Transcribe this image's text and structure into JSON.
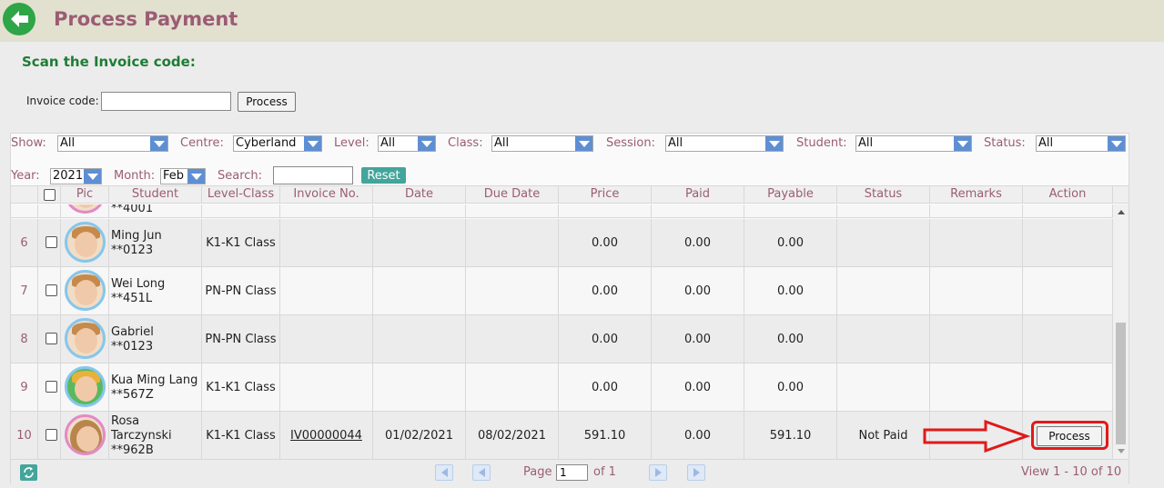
{
  "header": {
    "title": "Process Payment"
  },
  "scan": {
    "title": "Scan the Invoice code:",
    "label": "Invoice code:",
    "value": "",
    "button": "Process"
  },
  "filters": {
    "show": {
      "label": "Show:",
      "value": "All"
    },
    "centre": {
      "label": "Centre:",
      "value": "Cyberland"
    },
    "level": {
      "label": "Level:",
      "value": "All"
    },
    "class": {
      "label": "Class:",
      "value": "All"
    },
    "session": {
      "label": "Session:",
      "value": "All"
    },
    "student": {
      "label": "Student:",
      "value": "All"
    },
    "status": {
      "label": "Status:",
      "value": "All"
    },
    "year": {
      "label": "Year:",
      "value": "2021"
    },
    "month": {
      "label": "Month:",
      "value": "Feb"
    },
    "search": {
      "label": "Search:",
      "value": ""
    },
    "reset": "Reset"
  },
  "columns": [
    "Pic",
    "Student",
    "Level-Class",
    "Invoice No.",
    "Date",
    "Due Date",
    "Price",
    "Paid",
    "Payable",
    "Status",
    "Remarks",
    "Action"
  ],
  "rows": [
    {
      "num": "6",
      "name": "Ming Jun",
      "name2": "",
      "id": "**0123",
      "level": "K1-K1 Class",
      "invoice": "",
      "date": "",
      "due": "",
      "price": "0.00",
      "paid": "0.00",
      "payable": "0.00",
      "status": "",
      "remarks": "",
      "action": ""
    },
    {
      "num": "7",
      "name": "Wei Long",
      "name2": "",
      "id": "**451L",
      "level": "PN-PN Class",
      "invoice": "",
      "date": "",
      "due": "",
      "price": "0.00",
      "paid": "0.00",
      "payable": "0.00",
      "status": "",
      "remarks": "",
      "action": ""
    },
    {
      "num": "8",
      "name": "Gabriel",
      "name2": "",
      "id": "**0123",
      "level": "PN-PN Class",
      "invoice": "",
      "date": "",
      "due": "",
      "price": "0.00",
      "paid": "0.00",
      "payable": "0.00",
      "status": "",
      "remarks": "",
      "action": ""
    },
    {
      "num": "9",
      "name": "Kua Ming Lang",
      "name2": "",
      "id": "**567Z",
      "level": "K1-K1 Class",
      "invoice": "",
      "date": "",
      "due": "",
      "price": "0.00",
      "paid": "0.00",
      "payable": "0.00",
      "status": "",
      "remarks": "",
      "action": ""
    },
    {
      "num": "10",
      "name": "Rosa",
      "name2": "Tarczynski",
      "id": "**962B",
      "level": "K1-K1 Class",
      "invoice": "IV00000044",
      "date": "01/02/2021",
      "due": "08/02/2021",
      "price": "591.10",
      "paid": "0.00",
      "payable": "591.10",
      "status": "Not Paid",
      "remarks": "",
      "action": "Process"
    }
  ],
  "partial_row": {
    "id": "**4001"
  },
  "pager": {
    "page_label": "Page",
    "page_value": "1",
    "of_label": "of 1",
    "view": "View 1 - 10 of 10"
  },
  "colors": {
    "accent": "#9b5c74",
    "green": "#1e7c35",
    "teal": "#43a59b",
    "highlight": "#e11919"
  }
}
